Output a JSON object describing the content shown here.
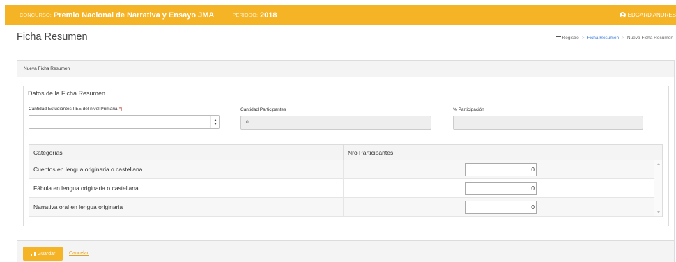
{
  "topbar": {
    "menu_icon": "hamburger-icon",
    "concurso_label": "CONCURSO:",
    "concurso_value": "Premio Nacional de Narrativa y Ensayo JMA",
    "periodo_label": "PERIODO:",
    "periodo_value": "2018",
    "user_icon": "user-circle-icon",
    "user_name": "EDGARD ANDRES",
    "color": "#f5b326"
  },
  "header": {
    "title": "Ficha Resumen",
    "breadcrumb": {
      "icon": "list-icon",
      "items": [
        "Registro",
        "Ficha Resumen",
        "Nueva Ficha Resumen"
      ]
    }
  },
  "panel": {
    "title": "Nueva Ficha Resumen",
    "section_title": "Datos de la Ficha Resumen",
    "fields": {
      "estudiantes_label": "Cantidad Estudiantes IIEE del nivel Primaria",
      "required_mark": "(*)",
      "estudiantes_value": "",
      "participantes_label": "Cantidad Participantes",
      "participantes_value": "0",
      "participacion_label": "% Participación",
      "participacion_value": ""
    },
    "table": {
      "headers": [
        "Categorías",
        "Nro Participantes"
      ],
      "rows": [
        {
          "categoria": "Cuentos en lengua originaria o castellana",
          "nro": "0"
        },
        {
          "categoria": "Fábula en lengua originaria o castellana",
          "nro": "0"
        },
        {
          "categoria": "Narrativa oral en lengua originaria",
          "nro": "0"
        }
      ]
    },
    "actions": {
      "save_icon": "floppy-disk-icon",
      "save_label": "Guardar",
      "cancel_label": "Cancelar"
    }
  }
}
